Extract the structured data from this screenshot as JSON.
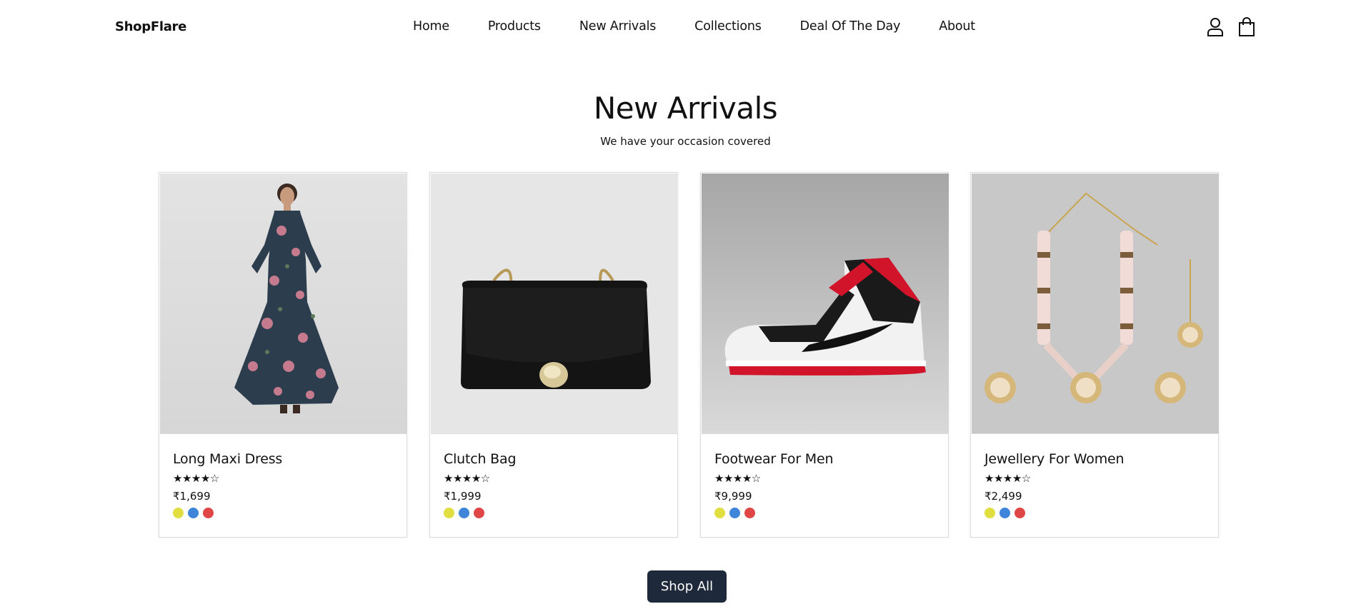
{
  "header": {
    "brand": "ShopFlare",
    "nav": [
      "Home",
      "Products",
      "New Arrivals",
      "Collections",
      "Deal Of The Day",
      "About"
    ],
    "icons": [
      "user-icon",
      "shopping-bag-icon"
    ]
  },
  "section": {
    "title": "New Arrivals",
    "subtitle": "We have your occasion covered"
  },
  "products": [
    {
      "name": "Long Maxi Dress",
      "stars": "★★★★☆",
      "rating": 4,
      "price": "₹1,699"
    },
    {
      "name": "Clutch Bag",
      "stars": "★★★★☆",
      "rating": 4,
      "price": "₹1,999"
    },
    {
      "name": "Footwear For Men",
      "stars": "★★★★☆",
      "rating": 4,
      "price": "₹9,999"
    },
    {
      "name": "Jewellery For Women",
      "stars": "★★★★☆",
      "rating": 4,
      "price": "₹2,499"
    }
  ],
  "swatch_colors": [
    "#e0df3f",
    "#3f86db",
    "#e04646"
  ],
  "shop_all_label": "Shop All"
}
